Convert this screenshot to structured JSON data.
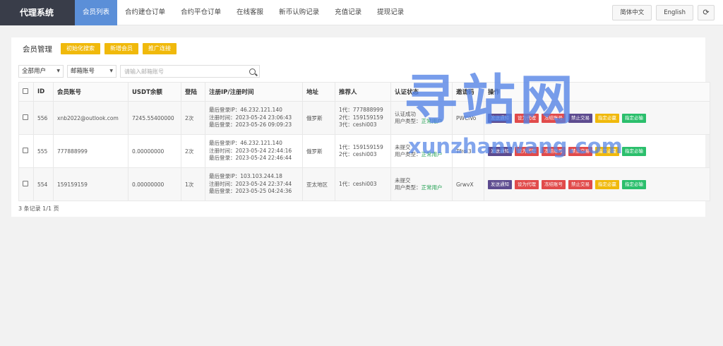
{
  "app": {
    "title": "代理系统"
  },
  "nav": [
    {
      "label": "会员列表",
      "active": true
    },
    {
      "label": "合约建仓订单"
    },
    {
      "label": "合约平仓订单"
    },
    {
      "label": "在线客服"
    },
    {
      "label": "新币认购记录"
    },
    {
      "label": "充值记录"
    },
    {
      "label": "提现记录"
    }
  ],
  "top_actions": {
    "lang_cn": "简体中文",
    "lang_en": "English",
    "refresh_icon": "refresh-icon"
  },
  "panel": {
    "title": "会员管理",
    "buttons": [
      "初始化搜索",
      "新增会员",
      "推广连接"
    ]
  },
  "filters": {
    "user_select": "全部用户",
    "type_select": "邮箱账号",
    "search_placeholder": "请输入邮箱账号"
  },
  "table": {
    "headers": [
      "ID",
      "会员账号",
      "USDT余额",
      "登陆",
      "注册IP/注册时间",
      "地址",
      "推荐人",
      "认证状态",
      "邀请码",
      "操作"
    ],
    "rows": [
      {
        "id": "556",
        "account": "xnb2022@outlook.com",
        "balance": "7245.55400000",
        "logins": "2次",
        "ip": [
          "最后登录IP：46.232.121.140",
          "注册时间：2023-05-24 23:06:43",
          "最后登录：2023-05-26 09:09:23"
        ],
        "address": "俄罗斯",
        "referrer": [
          "1代：777888999",
          "2代：159159159",
          "3代：ceshi003"
        ],
        "auth_status": "认证成功",
        "user_type_label": "用户类型：",
        "user_type": "正常用户",
        "invite_code": "PWCiVo"
      },
      {
        "id": "555",
        "account": "777888999",
        "balance": "0.00000000",
        "logins": "2次",
        "ip": [
          "最后登录IP：46.232.121.140",
          "注册时间：2023-05-24 22:44:16",
          "最后登录：2023-05-24 22:46:44"
        ],
        "address": "俄罗斯",
        "referrer": [
          "1代：159159159",
          "2代：ceshi003"
        ],
        "auth_status": "未提交",
        "user_type_label": "用户类型：",
        "user_type": "正常用户",
        "invite_code": "Tfroi3"
      },
      {
        "id": "554",
        "account": "159159159",
        "balance": "0.00000000",
        "logins": "1次",
        "ip": [
          "最后登录IP：103.103.244.18",
          "注册时间：2023-05-24 22:37:44",
          "最后登录：2023-05-25 04:24:36"
        ],
        "address": "亚太地区",
        "referrer": [
          "1代：ceshi003"
        ],
        "auth_status": "未提交",
        "user_type_label": "用户类型：",
        "user_type": "正常用户",
        "invite_code": "GrwvX"
      }
    ],
    "actions": [
      {
        "label": "发送通知",
        "color": "#5d4b8f"
      },
      {
        "label": "设为代理",
        "color": "#e14b4b"
      },
      {
        "label": "冻结账号",
        "color": "#e14b4b"
      },
      {
        "label": "禁止交易",
        "color": "#e14b4b"
      },
      {
        "label": "指定必赢",
        "color": "#f0b90b"
      },
      {
        "label": "指定必输",
        "color": "#2bbf6c"
      }
    ]
  },
  "footer": {
    "summary": "3 条记录 1/1 页"
  },
  "watermark": {
    "cn": "寻站网",
    "en": "xunzhanwang.com"
  }
}
